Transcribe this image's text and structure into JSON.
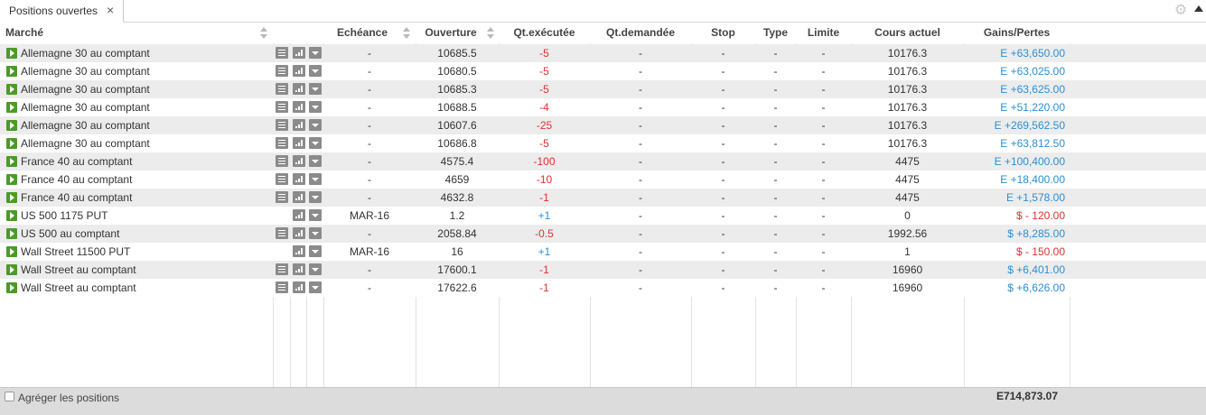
{
  "tab": {
    "title": "Positions ouvertes",
    "close": "×"
  },
  "icons": {
    "gear": "gear-icon",
    "close": "close-icon"
  },
  "columns": {
    "market": "Marché",
    "expiry": "Echéance",
    "open": "Ouverture",
    "qty_exec": "Qt.exécutée",
    "qty_req": "Qt.demandée",
    "stop": "Stop",
    "type": "Type",
    "limit": "Limite",
    "price": "Cours actuel",
    "pnl": "Gains/Pertes"
  },
  "colors": {
    "negative": "#e03030",
    "positive": "#2a8fd6",
    "play": "#4c9a2a"
  },
  "rows": [
    {
      "market": "Allemagne 30 au comptant",
      "sheet": true,
      "expiry": "-",
      "open": "10685.5",
      "qty": "-5",
      "qty_color": "red",
      "req": "-",
      "stop": "-",
      "type": "-",
      "limit": "-",
      "price": "10176.3",
      "pnl": "E +63,650.00",
      "pnl_color": "blue"
    },
    {
      "market": "Allemagne 30 au comptant",
      "sheet": true,
      "expiry": "-",
      "open": "10680.5",
      "qty": "-5",
      "qty_color": "red",
      "req": "-",
      "stop": "-",
      "type": "-",
      "limit": "-",
      "price": "10176.3",
      "pnl": "E +63,025.00",
      "pnl_color": "blue"
    },
    {
      "market": "Allemagne 30 au comptant",
      "sheet": true,
      "expiry": "-",
      "open": "10685.3",
      "qty": "-5",
      "qty_color": "red",
      "req": "-",
      "stop": "-",
      "type": "-",
      "limit": "-",
      "price": "10176.3",
      "pnl": "E +63,625.00",
      "pnl_color": "blue"
    },
    {
      "market": "Allemagne 30 au comptant",
      "sheet": true,
      "expiry": "-",
      "open": "10688.5",
      "qty": "-4",
      "qty_color": "red",
      "req": "-",
      "stop": "-",
      "type": "-",
      "limit": "-",
      "price": "10176.3",
      "pnl": "E +51,220.00",
      "pnl_color": "blue"
    },
    {
      "market": "Allemagne 30 au comptant",
      "sheet": true,
      "expiry": "-",
      "open": "10607.6",
      "qty": "-25",
      "qty_color": "red",
      "req": "-",
      "stop": "-",
      "type": "-",
      "limit": "-",
      "price": "10176.3",
      "pnl": "E +269,562.50",
      "pnl_color": "blue"
    },
    {
      "market": "Allemagne 30 au comptant",
      "sheet": true,
      "expiry": "-",
      "open": "10686.8",
      "qty": "-5",
      "qty_color": "red",
      "req": "-",
      "stop": "-",
      "type": "-",
      "limit": "-",
      "price": "10176.3",
      "pnl": "E +63,812.50",
      "pnl_color": "blue"
    },
    {
      "market": "France 40 au comptant",
      "sheet": true,
      "expiry": "-",
      "open": "4575.4",
      "qty": "-100",
      "qty_color": "red",
      "req": "-",
      "stop": "-",
      "type": "-",
      "limit": "-",
      "price": "4475",
      "pnl": "E +100,400.00",
      "pnl_color": "blue"
    },
    {
      "market": "France 40 au comptant",
      "sheet": true,
      "expiry": "-",
      "open": "4659",
      "qty": "-10",
      "qty_color": "red",
      "req": "-",
      "stop": "-",
      "type": "-",
      "limit": "-",
      "price": "4475",
      "pnl": "E +18,400.00",
      "pnl_color": "blue"
    },
    {
      "market": "France 40 au comptant",
      "sheet": true,
      "expiry": "-",
      "open": "4632.8",
      "qty": "-1",
      "qty_color": "red",
      "req": "-",
      "stop": "-",
      "type": "-",
      "limit": "-",
      "price": "4475",
      "pnl": "E +1,578.00",
      "pnl_color": "blue"
    },
    {
      "market": "US 500 1175 PUT",
      "sheet": false,
      "expiry": "MAR-16",
      "open": "1.2",
      "qty": "+1",
      "qty_color": "blue",
      "req": "-",
      "stop": "-",
      "type": "-",
      "limit": "-",
      "price": "0",
      "pnl": "$ - 120.00",
      "pnl_color": "red"
    },
    {
      "market": "US 500 au comptant",
      "sheet": true,
      "expiry": "-",
      "open": "2058.84",
      "qty": "-0.5",
      "qty_color": "red",
      "req": "-",
      "stop": "-",
      "type": "-",
      "limit": "-",
      "price": "1992.56",
      "pnl": "$ +8,285.00",
      "pnl_color": "blue"
    },
    {
      "market": "Wall Street 11500 PUT",
      "sheet": false,
      "expiry": "MAR-16",
      "open": "16",
      "qty": "+1",
      "qty_color": "blue",
      "req": "-",
      "stop": "-",
      "type": "-",
      "limit": "-",
      "price": "1",
      "pnl": "$ - 150.00",
      "pnl_color": "red"
    },
    {
      "market": "Wall Street au comptant",
      "sheet": true,
      "expiry": "-",
      "open": "17600.1",
      "qty": "-1",
      "qty_color": "red",
      "req": "-",
      "stop": "-",
      "type": "-",
      "limit": "-",
      "price": "16960",
      "pnl": "$ +6,401.00",
      "pnl_color": "blue"
    },
    {
      "market": "Wall Street au comptant",
      "sheet": true,
      "expiry": "-",
      "open": "17622.6",
      "qty": "-1",
      "qty_color": "red",
      "req": "-",
      "stop": "-",
      "type": "-",
      "limit": "-",
      "price": "16960",
      "pnl": "$ +6,626.00",
      "pnl_color": "blue"
    }
  ],
  "footer": {
    "aggregate_label": "Agréger les positions",
    "total": "E714,873.07"
  }
}
